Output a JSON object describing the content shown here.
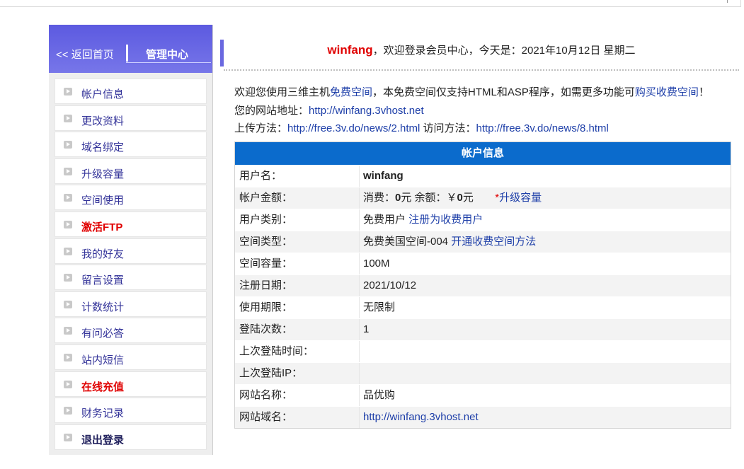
{
  "sidebar": {
    "back_label": "返回首页",
    "back_arrows": "<<",
    "title": "管理中心",
    "items": [
      {
        "label": "帐户信息"
      },
      {
        "label": "更改资料"
      },
      {
        "label": "域名绑定"
      },
      {
        "label": "升级容量"
      },
      {
        "label": "空间使用"
      },
      {
        "label": "激活FTP"
      },
      {
        "label": "我的好友"
      },
      {
        "label": "留言设置"
      },
      {
        "label": "计数统计"
      },
      {
        "label": "有问必答"
      },
      {
        "label": "站内短信"
      },
      {
        "label": "在线充值"
      },
      {
        "label": "财务记录"
      },
      {
        "label": "退出登录"
      }
    ]
  },
  "welcome": {
    "username": "winfang",
    "text": "，欢迎登录会员中心，今天是：2021年10月12日 星期二"
  },
  "intro": {
    "line1_a": "欢迎您使用三维主机",
    "line1_link1": "免费空间",
    "line1_b": "，本免费空间仅支持HTML和ASP程序，如需更多功能可",
    "line1_link2": "购买收费空间",
    "line1_c": "！",
    "line2_label": "您的网站地址：",
    "line2_link": "http://winfang.3vhost.net",
    "line3_label": "上传方法：",
    "line3_link1": "http://free.3v.do/news/2.html",
    "line3_mid": " 访问方法：",
    "line3_link2": "http://free.3v.do/news/8.html"
  },
  "account": {
    "title": "帐户信息",
    "rows": {
      "username": {
        "k": "用户名：",
        "v": "winfang"
      },
      "balance": {
        "k": "帐户金额：",
        "spend_label": "消费：",
        "spend": "0",
        "unit1": "元 余额：￥",
        "remain": "0",
        "unit2": "元",
        "star": "*",
        "upgrade": "升级容量"
      },
      "usertype": {
        "k": "用户类别：",
        "v": "免费用户",
        "link": "注册为收费用户"
      },
      "spacetype": {
        "k": "空间类型：",
        "v": "免费美国空间-004",
        "link": "开通收费空间方法"
      },
      "capacity": {
        "k": "空间容量：",
        "v": "100M"
      },
      "regdate": {
        "k": "注册日期：",
        "v": "2021/10/12"
      },
      "term": {
        "k": "使用期限：",
        "v": "无限制"
      },
      "logins": {
        "k": "登陆次数：",
        "v": "1"
      },
      "lasttime": {
        "k": "上次登陆时间：",
        "v": ""
      },
      "lastip": {
        "k": "上次登陆IP：",
        "v": ""
      },
      "sitename": {
        "k": "网站名称：",
        "v": "品优购"
      },
      "domain": {
        "k": "网站域名：",
        "v": "http://winfang.3vhost.net"
      }
    }
  },
  "colors": {
    "accent": "#6a68e0",
    "header_blue": "#0b6bcc",
    "alert_red": "#e00000",
    "link_blue": "#1d3ea8"
  }
}
